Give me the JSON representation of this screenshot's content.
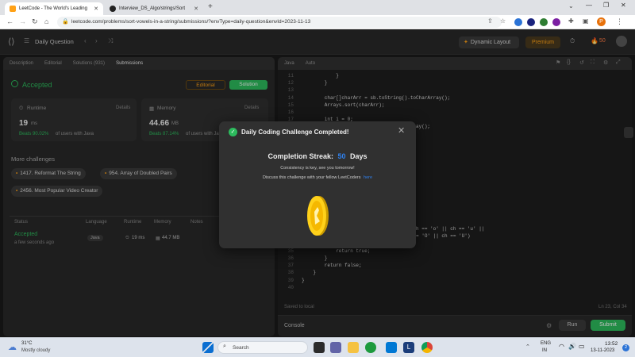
{
  "browser": {
    "tabs": [
      {
        "title": "LeetCode - The World's Leading",
        "active": true
      },
      {
        "title": "Interview_DS_Algo/strings/Sort",
        "active": false
      }
    ],
    "new_tab": "+",
    "url": "leetcode.com/problems/sort-vowels-in-a-string/submissions/?envType=daily-question&envId=2023-11-13",
    "profile_initial": "P"
  },
  "header": {
    "title": "Daily Question",
    "layout_button": "Dynamic Layout",
    "premium_button": "Premium",
    "streak_count": "50"
  },
  "left_panel": {
    "tabs": [
      "Description",
      "Editorial",
      "Solutions (931)",
      "Submissions"
    ],
    "status": "Accepted",
    "editorial_button": "Editorial",
    "solution_button": "Solution",
    "runtime": {
      "label": "Runtime",
      "details": "Details",
      "value": "19",
      "unit": "ms",
      "beats_pct": "Beats 90.02%",
      "beats_tail": "of users with Java"
    },
    "memory": {
      "label": "Memory",
      "details": "Details",
      "value": "44.66",
      "unit": "MB",
      "beats_pct": "Beats 87.14%",
      "beats_tail": "of users with Ja"
    },
    "more_challenges_title": "More challenges",
    "challenges": [
      "1417. Reformat The String",
      "954. Array of Doubled Pairs",
      "2456. Most Popular Video Creator"
    ],
    "table": {
      "headers": [
        "Status",
        "Language",
        "Runtime",
        "Memory",
        "Notes"
      ],
      "row": {
        "status": "Accepted",
        "time": "a few seconds ago",
        "language": "Java",
        "runtime": "19 ms",
        "memory": "44.7 MB"
      }
    }
  },
  "editor": {
    "language": "Java",
    "mode": "Auto",
    "lines": [
      {
        "n": "11",
        "t": "            }"
      },
      {
        "n": "12",
        "t": "        }"
      },
      {
        "n": "13",
        "t": ""
      },
      {
        "n": "14",
        "t": "        char[]charArr = sb.toString().toCharArray();"
      },
      {
        "n": "15",
        "t": "        Arrays.sort(charArr);"
      },
      {
        "n": "16",
        "t": ""
      },
      {
        "n": "17",
        "t": "        int i = 0;"
      },
      {
        "n": "18",
        "t": "                                        ay();"
      },
      {
        "n": "19",
        "t": ""
      },
      {
        "n": "20",
        "t": ""
      },
      {
        "n": "21",
        "t": ""
      },
      {
        "n": "22",
        "t": "                                      ];"
      },
      {
        "n": "23",
        "t": ""
      },
      {
        "n": "24",
        "t": ""
      },
      {
        "n": "25",
        "t": ""
      },
      {
        "n": "26",
        "t": ""
      },
      {
        "n": "27",
        "t": ""
      },
      {
        "n": "28",
        "t": ""
      },
      {
        "n": "29",
        "t": ""
      },
      {
        "n": "30",
        "t": ""
      },
      {
        "n": "31",
        "t": ""
      },
      {
        "n": "32",
        "t": "                          ch == 'i' || ch == 'o' || ch == 'u' ||"
      },
      {
        "n": "33",
        "t": "                          == 'I' || ch == 'O' || ch == 'U')"
      },
      {
        "n": "34",
        "t": "        {"
      },
      {
        "n": "35",
        "t": "            return true;"
      },
      {
        "n": "36",
        "t": "        }"
      },
      {
        "n": "37",
        "t": "        return false;"
      },
      {
        "n": "38",
        "t": "    }"
      },
      {
        "n": "39",
        "t": "}"
      },
      {
        "n": "40",
        "t": ""
      }
    ],
    "saved_text": "Saved to local",
    "cursor_pos": "Ln 23, Col 34",
    "console_label": "Console",
    "run_button": "Run",
    "submit_button": "Submit"
  },
  "modal": {
    "title": "Daily Coding Challenge Completed!",
    "streak_label": "Completion Streak:",
    "streak_value": "50",
    "streak_unit": "Days",
    "line1": "Consistency is key, see you tomorrow!",
    "line2": "Discuss this challenge with your fellow LeetCoders",
    "link": "here"
  },
  "taskbar": {
    "weather_temp": "31°C",
    "weather_text": "Mostly cloudy",
    "search": "Search",
    "lang1": "ENG",
    "lang2": "IN",
    "time": "13:52",
    "date": "13-11-2023",
    "notif": "2"
  },
  "colors": {
    "accepted": "#2cbb5d",
    "accent": "#ffa116",
    "link": "#2f80ed"
  }
}
